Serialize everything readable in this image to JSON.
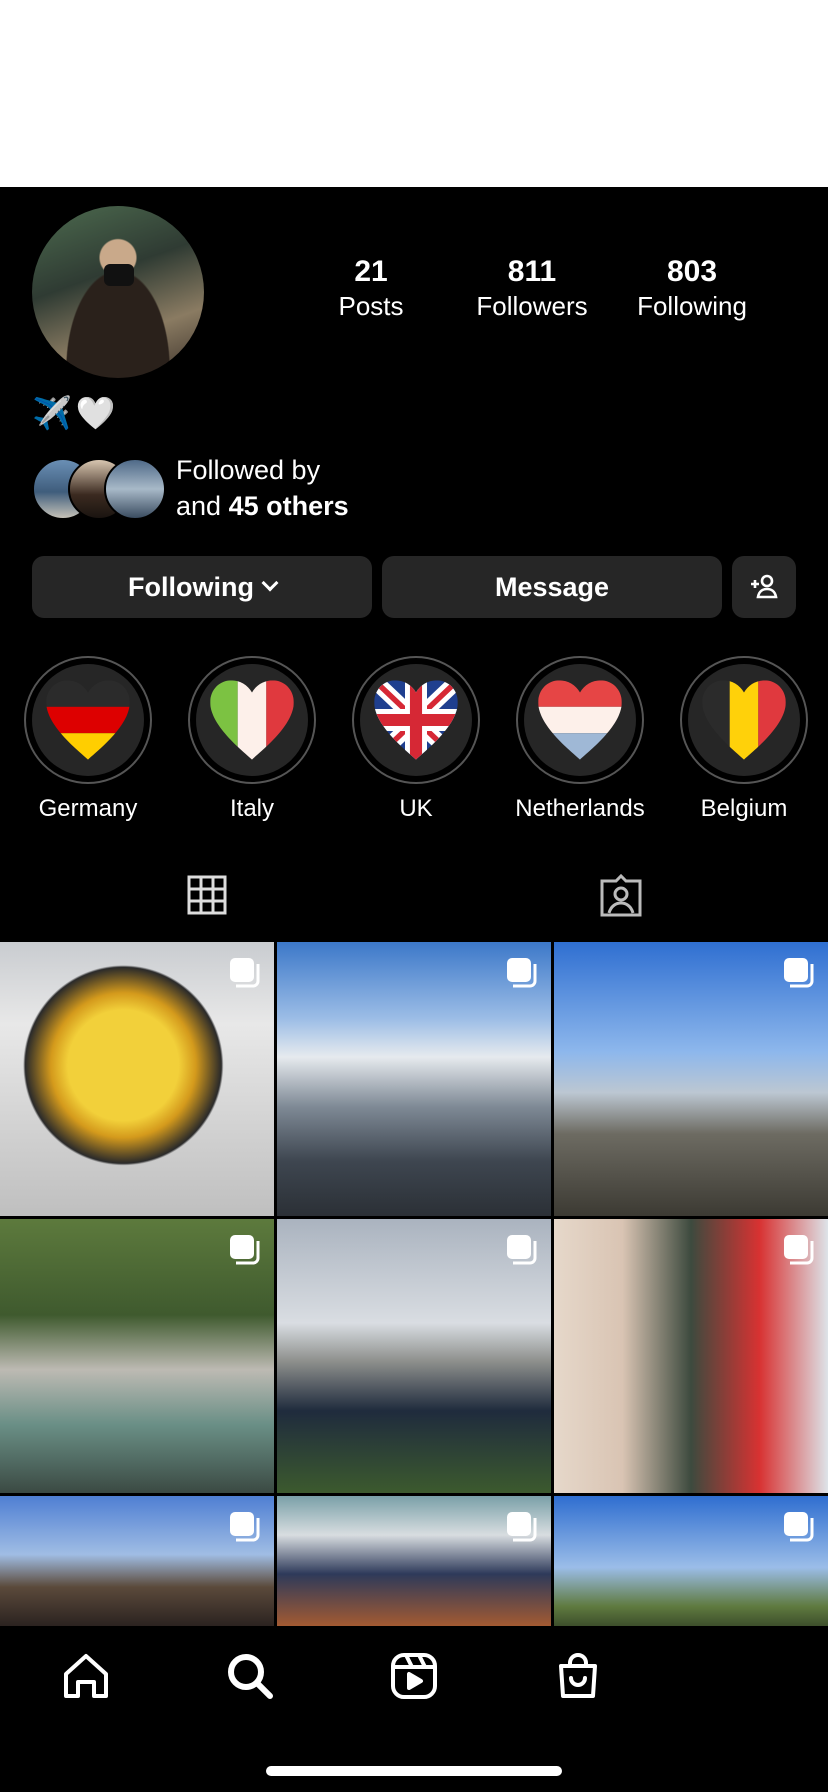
{
  "profile": {
    "stats": [
      {
        "number": "21",
        "label": "Posts"
      },
      {
        "number": "811",
        "label": "Followers"
      },
      {
        "number": "803",
        "label": "Following"
      }
    ],
    "bio_emoji": "✈️🤍",
    "followed_by_line1": "Followed by",
    "followed_by_prefix": "and ",
    "followed_by_count": "45 others"
  },
  "actions": {
    "following_label": "Following",
    "message_label": "Message",
    "add_icon": "add-person-icon"
  },
  "highlights": [
    {
      "label": "Germany",
      "colors": [
        "#2b2b2b",
        "#dd0000",
        "#ffce00"
      ]
    },
    {
      "label": "Italy",
      "colors": [
        "#7cc242",
        "#fdf0ea",
        "#e0393e"
      ]
    },
    {
      "label": "UK",
      "colors": [
        "#1f3f8f",
        "#ffffff",
        "#d62835"
      ]
    },
    {
      "label": "Netherlands",
      "colors": [
        "#e64545",
        "#fdf0ea",
        "#9fb8d6"
      ]
    },
    {
      "label": "Belgium",
      "colors": [
        "#2b2b2b",
        "#ffd10a",
        "#e0393e"
      ]
    }
  ],
  "tabs": [
    {
      "name": "grid-icon",
      "active": true
    },
    {
      "name": "tagged-icon",
      "active": false
    }
  ],
  "posts": [
    {
      "desc": "ski goggles reflection",
      "multi": true
    },
    {
      "desc": "mountain valley under clouds",
      "multi": true
    },
    {
      "desc": "city skyline by harbour",
      "multi": true
    },
    {
      "desc": "forest river with rocks",
      "multi": true
    },
    {
      "desc": "girl looking at city skyline",
      "multi": true
    },
    {
      "desc": "two friends selfie",
      "multi": true
    },
    {
      "desc": "town hall tower",
      "multi": true
    },
    {
      "desc": "group of friends outdoors",
      "multi": true
    },
    {
      "desc": "wind turbines landscape",
      "multi": true
    }
  ],
  "nav": [
    "home-icon",
    "search-icon",
    "reels-icon",
    "shop-icon"
  ]
}
